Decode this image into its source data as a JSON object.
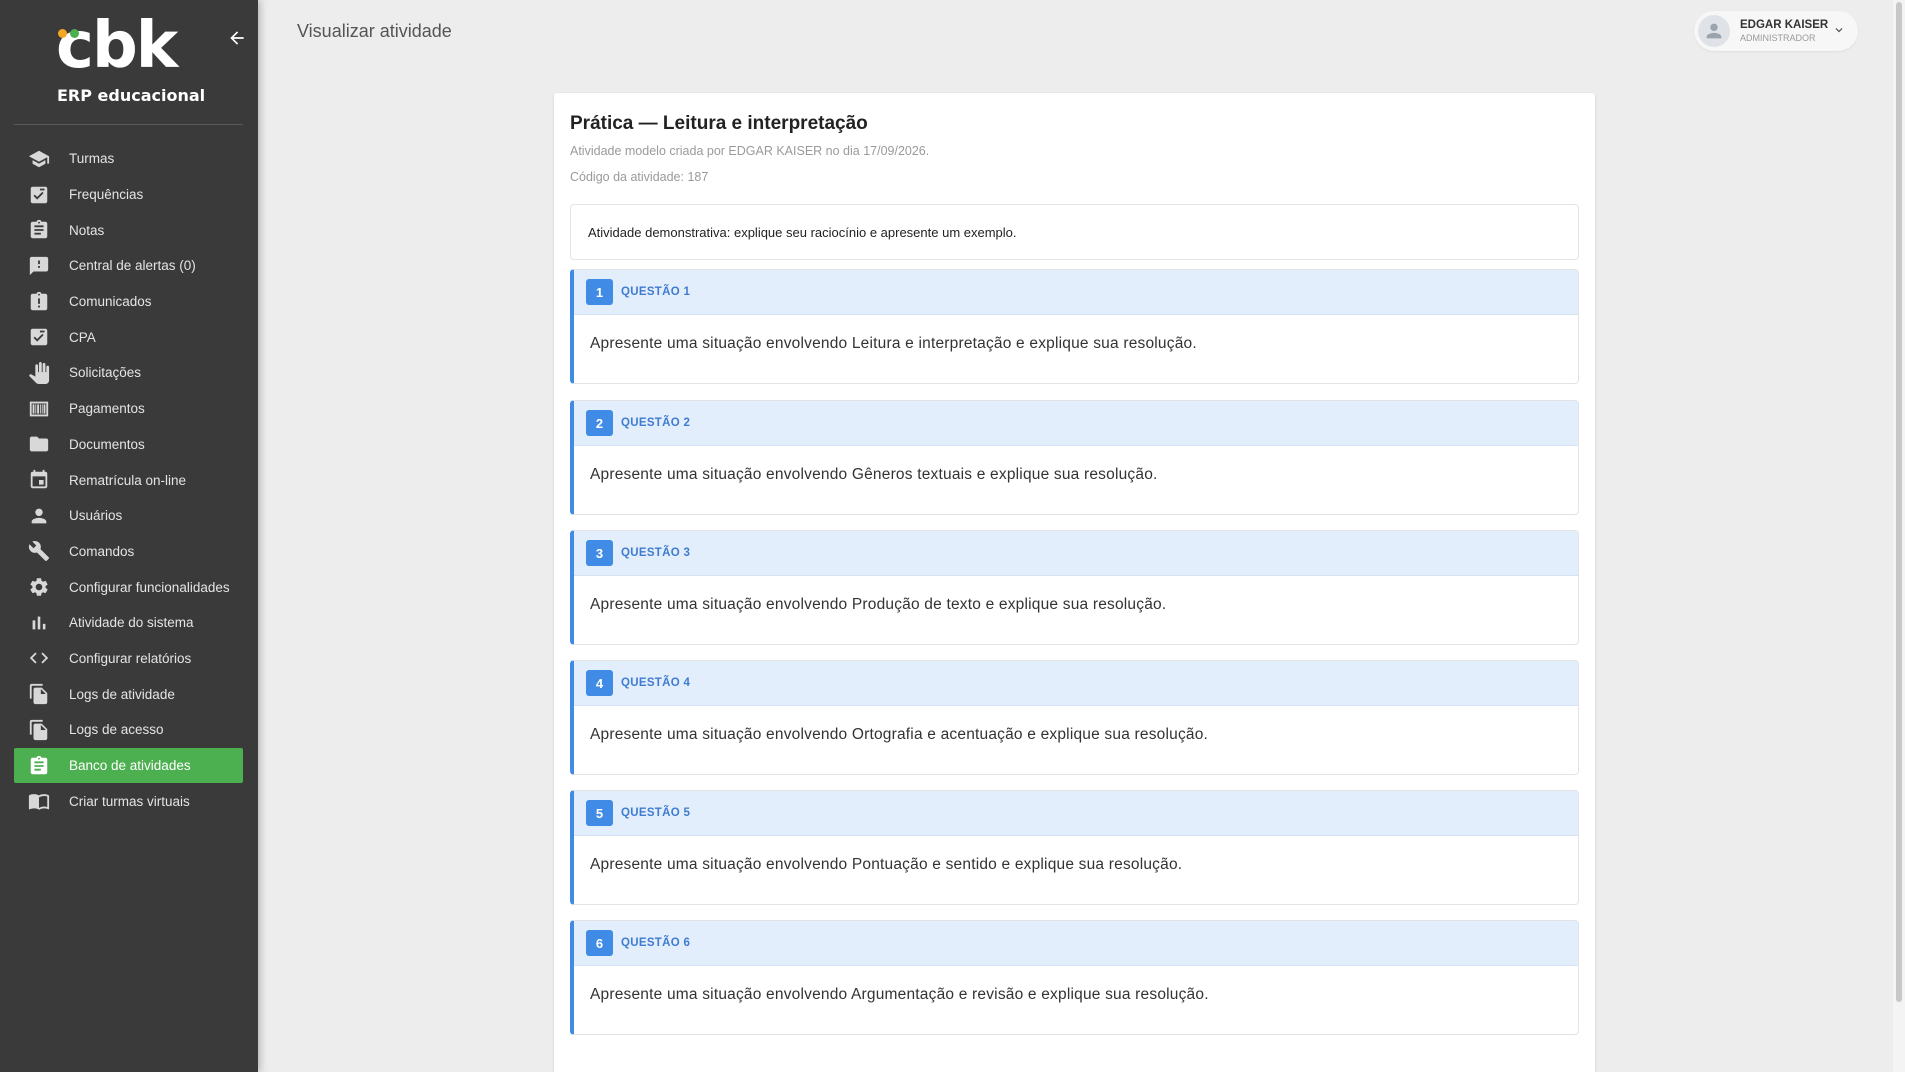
{
  "brand": {
    "logo_text": "cbk",
    "logo_sub": "ERP educacional",
    "dot_colors": [
      "#f5a623",
      "#4caf50"
    ]
  },
  "sidebar": {
    "items": [
      {
        "label": "Turmas",
        "icon": "graduation-cap-icon"
      },
      {
        "label": "Frequências",
        "icon": "checklist-icon"
      },
      {
        "label": "Notas",
        "icon": "clipboard-icon"
      },
      {
        "label": "Central de alertas (0)",
        "icon": "alert-chat-icon"
      },
      {
        "label": "Comunicados",
        "icon": "clipboard-alert-icon"
      },
      {
        "label": "CPA",
        "icon": "checklist-icon"
      },
      {
        "label": "Solicitações",
        "icon": "hand-icon"
      },
      {
        "label": "Pagamentos",
        "icon": "barcode-icon"
      },
      {
        "label": "Documentos",
        "icon": "folder-icon"
      },
      {
        "label": "Rematrícula on-line",
        "icon": "calendar-icon"
      },
      {
        "label": "Usuários",
        "icon": "person-icon"
      },
      {
        "label": "Comandos",
        "icon": "wrench-icon"
      },
      {
        "label": "Configurar funcionalidades",
        "icon": "gear-icon"
      },
      {
        "label": "Atividade do sistema",
        "icon": "bar-chart-icon"
      },
      {
        "label": "Configurar relatórios",
        "icon": "code-icon"
      },
      {
        "label": "Logs de atividade",
        "icon": "copy-icon"
      },
      {
        "label": "Logs de acesso",
        "icon": "copy-icon"
      },
      {
        "label": "Banco de atividades",
        "icon": "clipboard-text-icon",
        "active": true
      },
      {
        "label": "Criar turmas virtuais",
        "icon": "book-icon"
      }
    ],
    "active_color": "#4caf50"
  },
  "header": {
    "title": "Visualizar atividade",
    "user": {
      "name": "EDGAR KAISER",
      "role": "ADMINISTRADOR",
      "avatar_alt": "Avatar"
    }
  },
  "activity": {
    "title": "Prática — Leitura e interpretação",
    "meta": "Atividade modelo criada por EDGAR KAISER no dia 17/09/2026.",
    "code": "Código da atividade: 187",
    "description": "Atividade demonstrativa: explique seu raciocínio e apresente um exemplo.",
    "questions": [
      {
        "number": "1",
        "label": "QUESTÃO 1",
        "text": "Apresente uma situação envolvendo Leitura e interpretação e explique sua resolução."
      },
      {
        "number": "2",
        "label": "QUESTÃO 2",
        "text": "Apresente uma situação envolvendo Gêneros textuais e explique sua resolução."
      },
      {
        "number": "3",
        "label": "QUESTÃO 3",
        "text": "Apresente uma situação envolvendo Produção de texto e explique sua resolução."
      },
      {
        "number": "4",
        "label": "QUESTÃO 4",
        "text": "Apresente uma situação envolvendo Ortografia e acentuação e explique sua resolução."
      },
      {
        "number": "5",
        "label": "QUESTÃO 5",
        "text": "Apresente uma situação envolvendo Pontuação e sentido e explique sua resolução."
      },
      {
        "number": "6",
        "label": "QUESTÃO 6",
        "text": "Apresente uma situação envolvendo Argumentação e revisão e explique sua resolução."
      }
    ],
    "accent_color": "#3f8be6"
  }
}
